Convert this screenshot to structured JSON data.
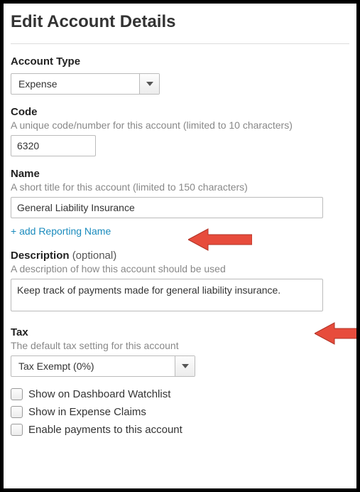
{
  "title": "Edit Account Details",
  "account_type": {
    "label": "Account Type",
    "value": "Expense"
  },
  "code": {
    "label": "Code",
    "hint": "A unique code/number for this account (limited to 10 characters)",
    "value": "6320"
  },
  "name": {
    "label": "Name",
    "hint": "A short title for this account (limited to 150 characters)",
    "value": "General Liability Insurance"
  },
  "add_reporting_name": "+ add Reporting Name",
  "description": {
    "label": "Description",
    "optional": "(optional)",
    "hint": "A description of how this account should be used",
    "value": "Keep track of payments made for general liability insurance."
  },
  "tax": {
    "label": "Tax",
    "hint": "The default tax setting for this account",
    "value": "Tax Exempt (0%)"
  },
  "checkboxes": {
    "dashboard": "Show on Dashboard Watchlist",
    "expense_claims": "Show in Expense Claims",
    "enable_payments": "Enable payments to this account"
  }
}
